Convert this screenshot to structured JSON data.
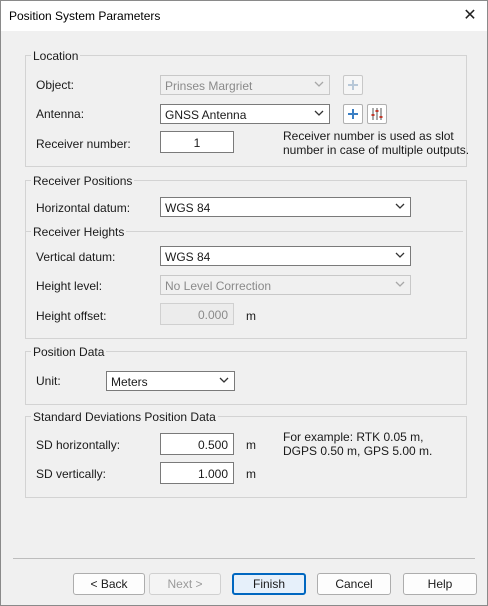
{
  "window": {
    "title": "Position System Parameters"
  },
  "location": {
    "title": "Location",
    "object_label": "Object:",
    "object_value": "Prinses Margriet",
    "antenna_label": "Antenna:",
    "antenna_value": "GNSS Antenna",
    "receiver_label": "Receiver number:",
    "receiver_value": "1",
    "receiver_note_1": "Receiver number is used as slot",
    "receiver_note_2": "number in case of multiple outputs."
  },
  "receiver_positions": {
    "title": "Receiver Positions",
    "horizontal_label": "Horizontal datum:",
    "horizontal_value": "WGS 84"
  },
  "receiver_heights": {
    "title": "Receiver Heights",
    "vertical_label": "Vertical datum:",
    "vertical_value": "WGS 84",
    "height_level_label": "Height level:",
    "height_level_value": "No Level Correction",
    "height_offset_label": "Height offset:",
    "height_offset_value": "0.000",
    "height_offset_unit": "m"
  },
  "position_data": {
    "title": "Position Data",
    "unit_label": "Unit:",
    "unit_value": "Meters"
  },
  "std_dev": {
    "title": "Standard Deviations Position Data",
    "sd_h_label": "SD horizontally:",
    "sd_h_value": "0.500",
    "sd_h_unit": "m",
    "sd_v_label": "SD vertically:",
    "sd_v_value": "1.000",
    "sd_v_unit": "m",
    "note_1": "For example: RTK 0.05 m,",
    "note_2": "DGPS 0.50 m, GPS 5.00 m."
  },
  "buttons": {
    "back": "< Back",
    "next": "Next >",
    "finish": "Finish",
    "cancel": "Cancel",
    "help": "Help"
  }
}
